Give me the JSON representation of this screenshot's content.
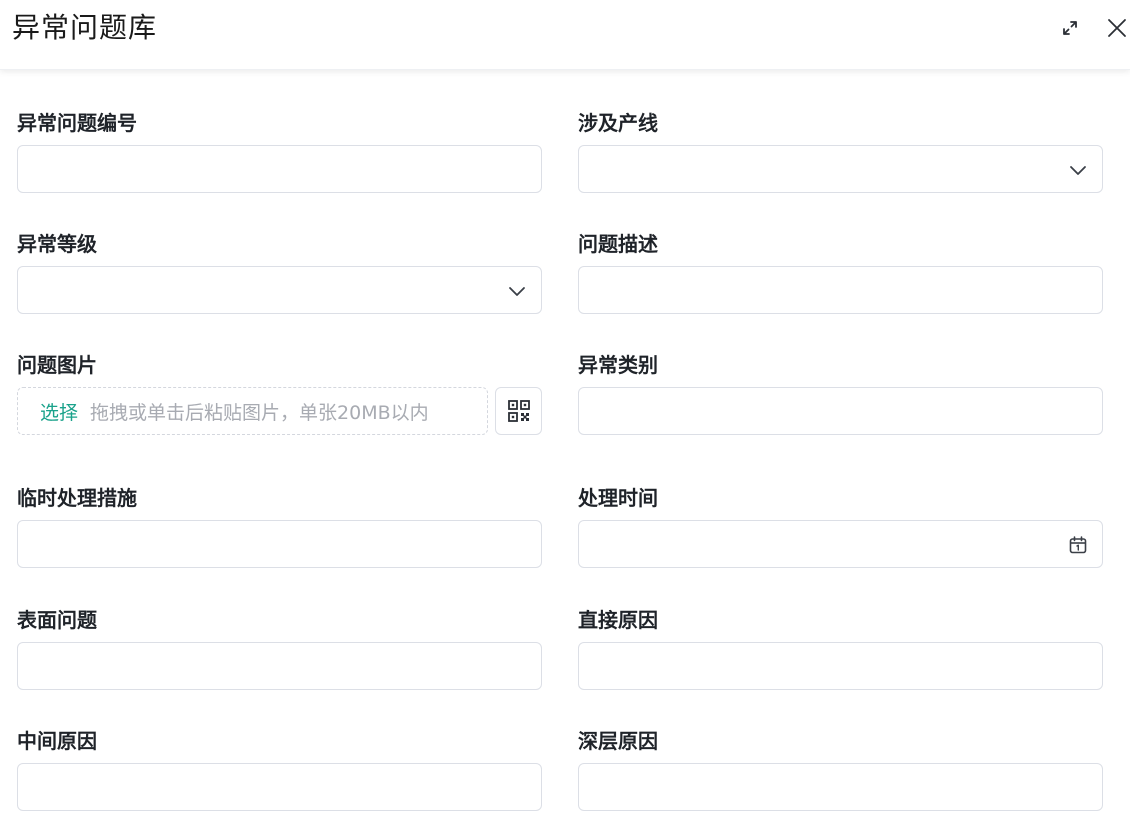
{
  "dialog": {
    "title": "异常问题库",
    "expand_icon": "expand-icon",
    "close_icon": "close-icon"
  },
  "form": {
    "problem_no": {
      "label": "异常问题编号",
      "value": ""
    },
    "production_line": {
      "label": "涉及产线",
      "value": "",
      "icon": "chevron-down-icon"
    },
    "level": {
      "label": "异常等级",
      "value": "",
      "icon": "chevron-down-icon"
    },
    "description": {
      "label": "问题描述",
      "value": ""
    },
    "image": {
      "label": "问题图片",
      "select_text": "选择",
      "hint": "拖拽或单击后粘贴图片，单张20MB以内",
      "icon": "qr-code-icon"
    },
    "category": {
      "label": "异常类别",
      "value": ""
    },
    "temp_measures": {
      "label": "临时处理措施",
      "value": ""
    },
    "handle_time": {
      "label": "处理时间",
      "value": "",
      "icon": "calendar-icon"
    },
    "surface_problem": {
      "label": "表面问题",
      "value": ""
    },
    "direct_cause": {
      "label": "直接原因",
      "value": ""
    },
    "intermediate_cause": {
      "label": "中间原因",
      "value": ""
    },
    "deep_cause": {
      "label": "深层原因",
      "value": ""
    }
  }
}
